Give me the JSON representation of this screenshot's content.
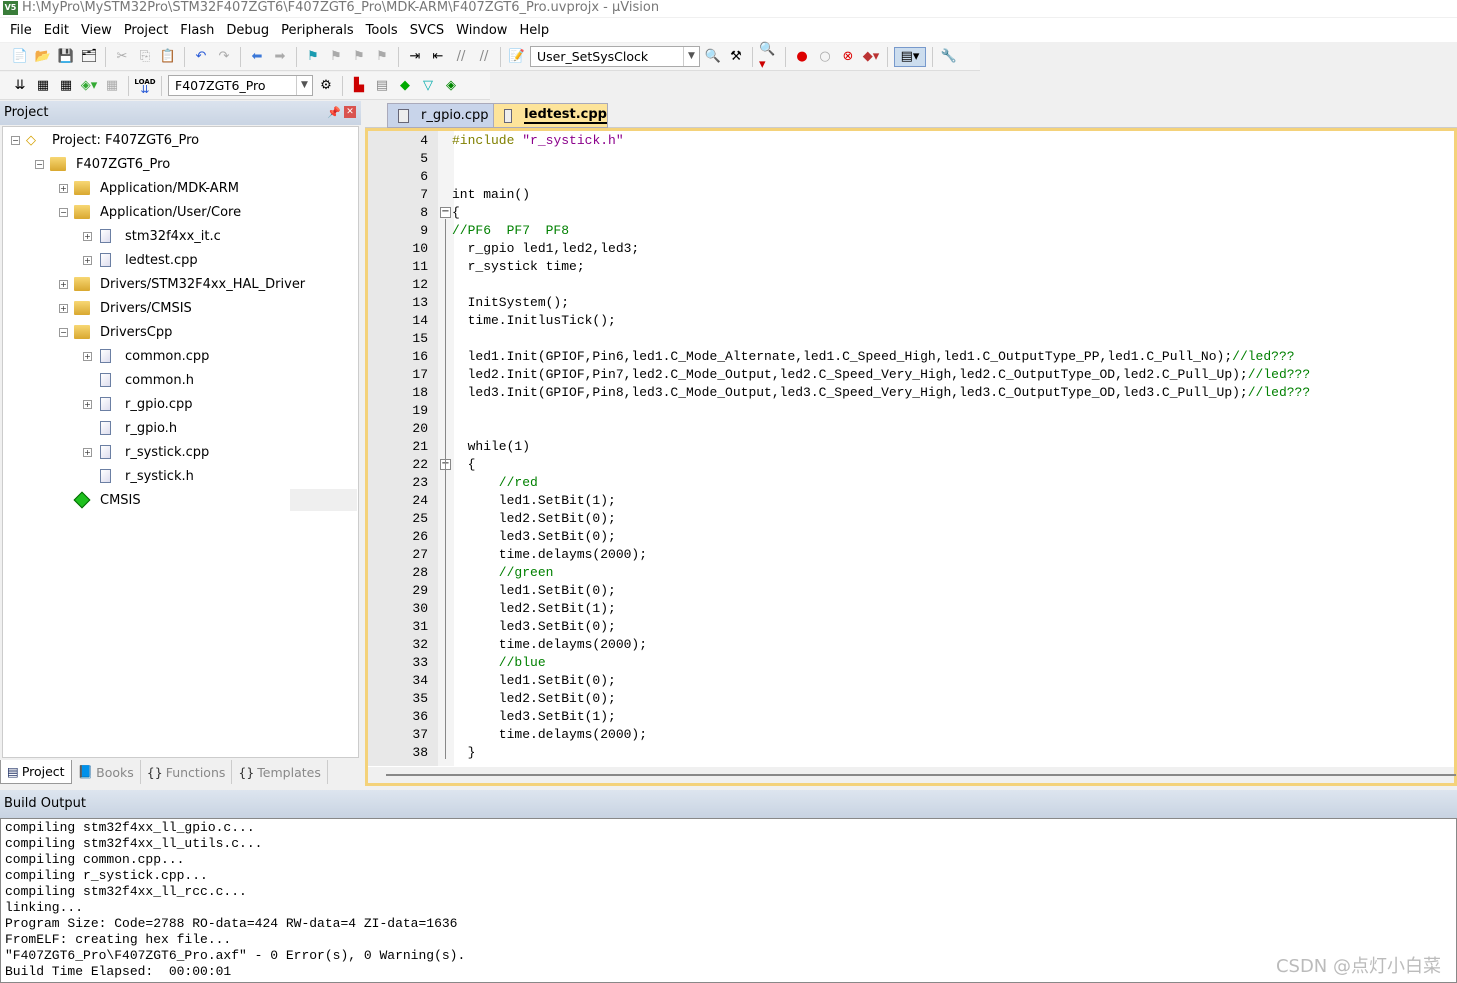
{
  "window": {
    "title": "H:\\MyPro\\MySTM32Pro\\STM32F407ZGT6\\F407ZGT6_Pro\\MDK-ARM\\F407ZGT6_Pro.uvprojx - µVision",
    "icon": "uvision-logo-icon"
  },
  "menu": [
    "File",
    "Edit",
    "View",
    "Project",
    "Flash",
    "Debug",
    "Peripherals",
    "Tools",
    "SVCS",
    "Window",
    "Help"
  ],
  "toolbar1": {
    "function_combo": "User_SetSysClock"
  },
  "toolbar2": {
    "target_combo": "F407ZGT6_Pro",
    "load_label": "LOAD"
  },
  "project_panel": {
    "title": "Project",
    "tree": [
      {
        "label": "Project: F407ZGT6_Pro",
        "level": 0,
        "expander": "minus",
        "icon": "project"
      },
      {
        "label": "F407ZGT6_Pro",
        "level": 1,
        "expander": "minus",
        "icon": "target"
      },
      {
        "label": "Application/MDK-ARM",
        "level": 2,
        "expander": "plus",
        "icon": "folder"
      },
      {
        "label": "Application/User/Core",
        "level": 2,
        "expander": "minus",
        "icon": "folder"
      },
      {
        "label": "stm32f4xx_it.c",
        "level": 3,
        "expander": "plus",
        "icon": "file"
      },
      {
        "label": "ledtest.cpp",
        "level": 3,
        "expander": "plus",
        "icon": "file"
      },
      {
        "label": "Drivers/STM32F4xx_HAL_Driver",
        "level": 2,
        "expander": "plus",
        "icon": "folder"
      },
      {
        "label": "Drivers/CMSIS",
        "level": 2,
        "expander": "plus",
        "icon": "folder"
      },
      {
        "label": "DriversCpp",
        "level": 2,
        "expander": "minus",
        "icon": "folder"
      },
      {
        "label": "common.cpp",
        "level": 3,
        "expander": "plus",
        "icon": "file"
      },
      {
        "label": "common.h",
        "level": 3,
        "expander": "none",
        "icon": "file"
      },
      {
        "label": "r_gpio.cpp",
        "level": 3,
        "expander": "plus",
        "icon": "file"
      },
      {
        "label": "r_gpio.h",
        "level": 3,
        "expander": "none",
        "icon": "file"
      },
      {
        "label": "r_systick.cpp",
        "level": 3,
        "expander": "plus",
        "icon": "file"
      },
      {
        "label": "r_systick.h",
        "level": 3,
        "expander": "none",
        "icon": "file"
      },
      {
        "label": "CMSIS",
        "level": 2,
        "expander": "none",
        "icon": "component",
        "selected": true
      }
    ],
    "tabs": [
      {
        "label": "Project",
        "active": true
      },
      {
        "label": "Books"
      },
      {
        "label": "Functions"
      },
      {
        "label": "Templates"
      }
    ]
  },
  "editor": {
    "tabs": [
      {
        "label": "r_gpio.cpp",
        "active": false
      },
      {
        "label": "ledtest.cpp",
        "active": true
      }
    ],
    "first_line": 4,
    "lines": [
      "#include \"r_systick.h\"",
      "",
      "",
      "int main()",
      "{",
      "//PF6  PF7  PF8",
      "  r_gpio led1,led2,led3;",
      "  r_systick time;",
      "",
      "  InitSystem();",
      "  time.InitlusTick();",
      "",
      "  led1.Init(GPIOF,Pin6,led1.C_Mode_Alternate,led1.C_Speed_High,led1.C_OutputType_PP,led1.C_Pull_No);//led???",
      "  led2.Init(GPIOF,Pin7,led2.C_Mode_Output,led2.C_Speed_Very_High,led2.C_OutputType_OD,led2.C_Pull_Up);//led???",
      "  led3.Init(GPIOF,Pin8,led3.C_Mode_Output,led3.C_Speed_Very_High,led3.C_OutputType_OD,led3.C_Pull_Up);//led???",
      "",
      "",
      "  while(1)",
      "  {",
      "      //red",
      "      led1.SetBit(1);",
      "      led2.SetBit(0);",
      "      led3.SetBit(0);",
      "      time.delayms(2000);",
      "      //green",
      "      led1.SetBit(0);",
      "      led2.SetBit(1);",
      "      led3.SetBit(0);",
      "      time.delayms(2000);",
      "      //blue",
      "      led1.SetBit(0);",
      "      led2.SetBit(0);",
      "      led3.SetBit(1);",
      "      time.delayms(2000);",
      "  }"
    ]
  },
  "build_output": {
    "title": "Build Output",
    "lines": [
      "compiling stm32f4xx_ll_gpio.c...",
      "compiling stm32f4xx_ll_utils.c...",
      "compiling common.cpp...",
      "compiling r_systick.cpp...",
      "compiling stm32f4xx_ll_rcc.c...",
      "linking...",
      "Program Size: Code=2788 RO-data=424 RW-data=4 ZI-data=1636",
      "FromELF: creating hex file...",
      "\"F407ZGT6_Pro\\F407ZGT6_Pro.axf\" - 0 Error(s), 0 Warning(s).",
      "Build Time Elapsed:  00:00:01"
    ]
  },
  "watermark": "CSDN @点灯小白菜",
  "colors": {
    "keyword": "#0000ff",
    "number": "#8b008b",
    "comment": "#008000",
    "preprocessor": "#808000",
    "active_tab": "#fde49a"
  }
}
